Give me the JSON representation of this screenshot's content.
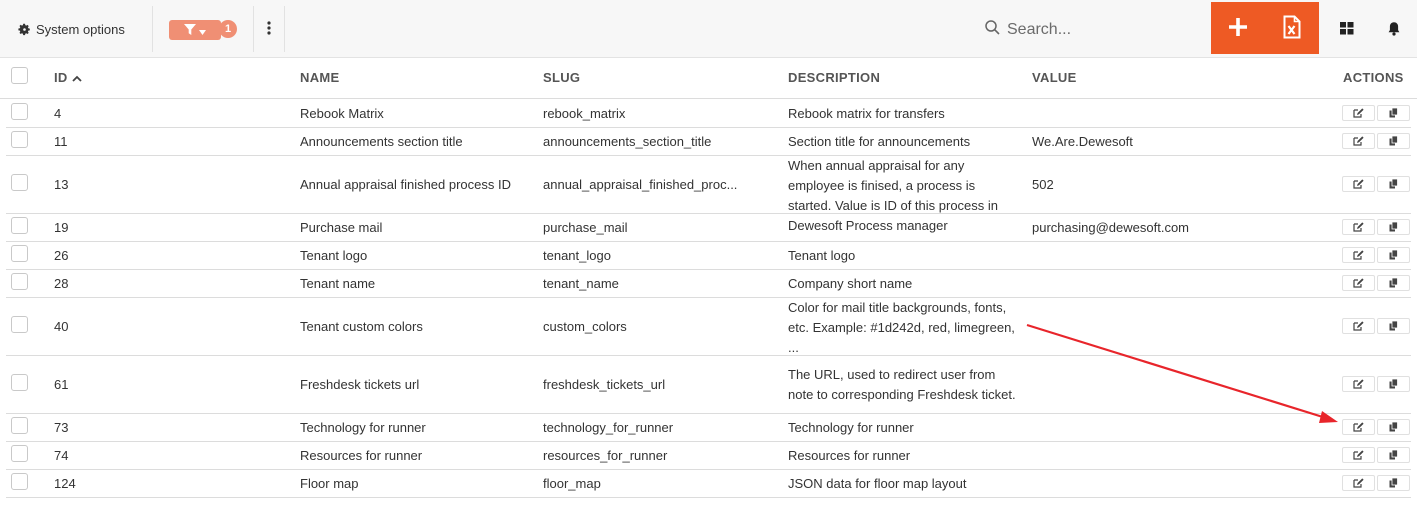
{
  "toolbar": {
    "system_options_label": "System options",
    "filter_count": "1",
    "search_placeholder": "Search...",
    "accent_color": "#ee5a24",
    "filter_color": "#f08f74"
  },
  "columns": {
    "id": "ID",
    "name": "NAME",
    "slug": "SLUG",
    "description": "DESCRIPTION",
    "value": "VALUE",
    "actions": "ACTIONS"
  },
  "sort": {
    "column": "ID",
    "direction": "ascending"
  },
  "rows": [
    {
      "id": "4",
      "name": "Rebook Matrix",
      "slug": "rebook_matrix",
      "description": "Rebook matrix for transfers",
      "value": ""
    },
    {
      "id": "11",
      "name": "Announcements section title",
      "slug": "announcements_section_title",
      "description": "Section title for announcements",
      "value": "We.Are.Dewesoft"
    },
    {
      "id": "13",
      "name": "Annual appraisal finished process ID",
      "slug": "annual_appraisal_finished_proc...",
      "description": "When annual appraisal for any employee is finised, a process is started. Value is ID of this process in Dewesoft Process manager",
      "value": "502"
    },
    {
      "id": "19",
      "name": "Purchase mail",
      "slug": "purchase_mail",
      "description": "",
      "value": "purchasing@dewesoft.com"
    },
    {
      "id": "26",
      "name": "Tenant logo",
      "slug": "tenant_logo",
      "description": "Tenant logo",
      "value": ""
    },
    {
      "id": "28",
      "name": "Tenant name",
      "slug": "tenant_name",
      "description": "Company short name",
      "value": ""
    },
    {
      "id": "40",
      "name": "Tenant custom colors",
      "slug": "custom_colors",
      "description": "Color for mail title backgrounds, fonts, etc. Example: #1d242d, red, limegreen, ...",
      "value": ""
    },
    {
      "id": "61",
      "name": "Freshdesk tickets url",
      "slug": "freshdesk_tickets_url",
      "description": "The URL, used to redirect user from note to corresponding Freshdesk ticket.",
      "value": ""
    },
    {
      "id": "73",
      "name": "Technology for runner",
      "slug": "technology_for_runner",
      "description": "Technology for runner",
      "value": ""
    },
    {
      "id": "74",
      "name": "Resources for runner",
      "slug": "resources_for_runner",
      "description": "Resources for runner",
      "value": ""
    },
    {
      "id": "124",
      "name": "Floor map",
      "slug": "floor_map",
      "description": "JSON data for floor map layout",
      "value": ""
    }
  ],
  "annotation": {
    "type": "arrow",
    "color": "#e8252b",
    "points_to": "edit button of row 61"
  }
}
